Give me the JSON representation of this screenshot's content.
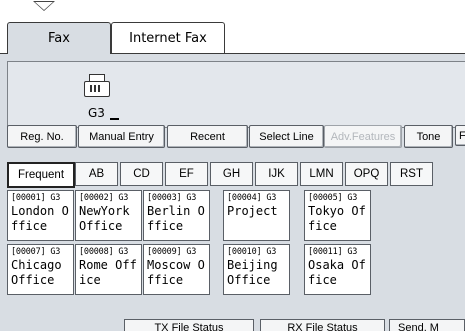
{
  "tabs": [
    {
      "label": "Fax"
    },
    {
      "label": "Internet Fax"
    }
  ],
  "destination": {
    "line_type": "G3",
    "icon": "fax-machine-icon"
  },
  "toolbar": {
    "reg_no": "Reg. No.",
    "manual_entry": "Manual Entry",
    "recent": "Recent",
    "select_line": "Select Line",
    "adv_features": "Adv.Features",
    "tone": "Tone",
    "overflow": "F"
  },
  "categories": [
    "Frequent",
    "AB",
    "CD",
    "EF",
    "GH",
    "IJK",
    "LMN",
    "OPQ",
    "RST"
  ],
  "entries": [
    {
      "code": "[00001] G3",
      "name": "London Office"
    },
    {
      "code": "[00002] G3",
      "name": "NewYork Office"
    },
    {
      "code": "[00003] G3",
      "name": "Berlin Office"
    },
    {
      "code": "[00004] G3",
      "name": "Project"
    },
    {
      "code": "[00005] G3",
      "name": "Tokyo Office"
    },
    {
      "code": "[00007] G3",
      "name": "Chicago Office"
    },
    {
      "code": "[00008] G3",
      "name": "Rome Office"
    },
    {
      "code": "[00009] G3",
      "name": "Moscow Office"
    },
    {
      "code": "[00010] G3",
      "name": "Beijing Office"
    },
    {
      "code": "[00011] G3",
      "name": "Osaka Office"
    }
  ],
  "bottom_buttons": {
    "tx_file_status": "TX File Status",
    "rx_file_status": "RX File Status",
    "send_more": "Send. M"
  }
}
